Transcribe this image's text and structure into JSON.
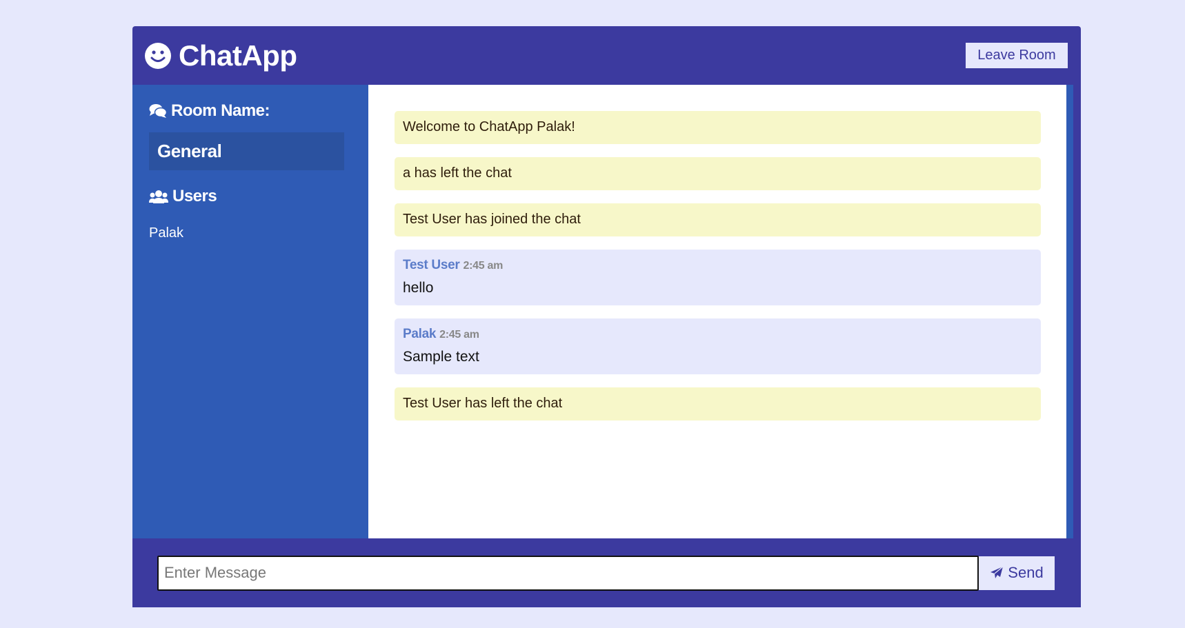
{
  "app": {
    "title": "ChatApp",
    "logo_icon": "smiley-icon",
    "leave_label": "Leave Room"
  },
  "colors": {
    "page_bg": "#e6e8fc",
    "header_bg": "#3c3a9f",
    "sidebar_bg": "#2f5bb5",
    "room_bg": "#2b52a0",
    "notice_bg": "#f7f7c9",
    "user_msg_bg": "#e6e8fc",
    "author_color": "#5b7cc9"
  },
  "sidebar": {
    "room_heading": "Room Name:",
    "room_icon": "comments-icon",
    "room_name": "General",
    "users_heading": "Users",
    "users_icon": "users-icon",
    "users": [
      "Palak"
    ]
  },
  "messages": [
    {
      "type": "notice",
      "text": "Welcome to ChatApp Palak!"
    },
    {
      "type": "notice",
      "text": "a has left the chat"
    },
    {
      "type": "notice",
      "text": "Test User has joined the chat"
    },
    {
      "type": "user",
      "author": "Test User",
      "time": "2:45 am",
      "text": "hello"
    },
    {
      "type": "user",
      "author": "Palak",
      "time": "2:45 am",
      "text": "Sample text"
    },
    {
      "type": "notice",
      "text": "Test User has left the chat"
    }
  ],
  "composer": {
    "placeholder": "Enter Message",
    "value": "",
    "send_label": "Send",
    "send_icon": "paper-plane-icon"
  }
}
